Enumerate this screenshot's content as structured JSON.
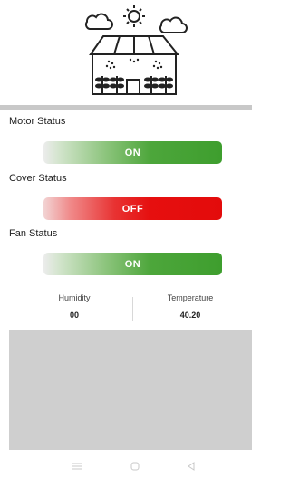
{
  "header": {
    "logo_icon": "greenhouse-logo-icon"
  },
  "controls": [
    {
      "label": "Motor Status",
      "state": "ON",
      "color": "#3e9e2e"
    },
    {
      "label": "Cover Status",
      "state": "OFF",
      "color": "#e30b0b"
    },
    {
      "label": "Fan Status",
      "state": "ON",
      "color": "#3e9e2e"
    }
  ],
  "readings": {
    "humidity": {
      "label": "Humidity",
      "value": "00"
    },
    "temperature": {
      "label": "Temperature",
      "value": "40.20"
    }
  },
  "navbar": {
    "icons": [
      "menu-icon",
      "home-icon",
      "back-icon"
    ]
  }
}
